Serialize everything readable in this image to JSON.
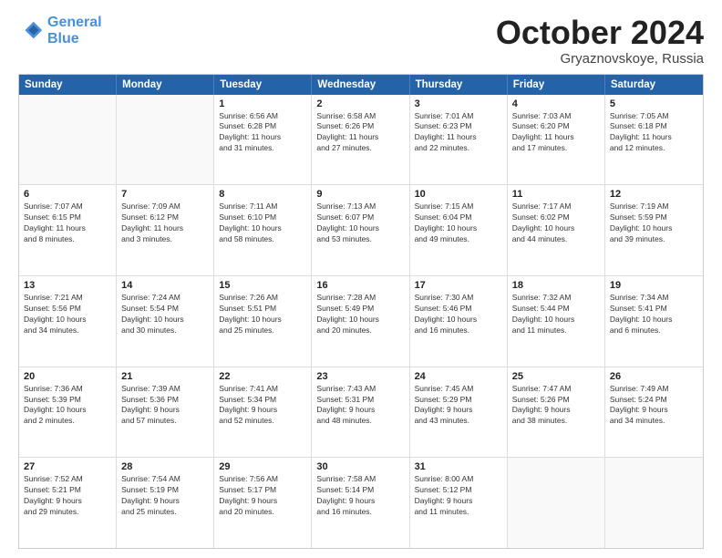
{
  "header": {
    "logo_line1": "General",
    "logo_line2": "Blue",
    "month": "October 2024",
    "location": "Gryaznovskoye, Russia"
  },
  "weekdays": [
    "Sunday",
    "Monday",
    "Tuesday",
    "Wednesday",
    "Thursday",
    "Friday",
    "Saturday"
  ],
  "rows": [
    [
      {
        "day": "",
        "text": ""
      },
      {
        "day": "",
        "text": ""
      },
      {
        "day": "1",
        "text": "Sunrise: 6:56 AM\nSunset: 6:28 PM\nDaylight: 11 hours\nand 31 minutes."
      },
      {
        "day": "2",
        "text": "Sunrise: 6:58 AM\nSunset: 6:26 PM\nDaylight: 11 hours\nand 27 minutes."
      },
      {
        "day": "3",
        "text": "Sunrise: 7:01 AM\nSunset: 6:23 PM\nDaylight: 11 hours\nand 22 minutes."
      },
      {
        "day": "4",
        "text": "Sunrise: 7:03 AM\nSunset: 6:20 PM\nDaylight: 11 hours\nand 17 minutes."
      },
      {
        "day": "5",
        "text": "Sunrise: 7:05 AM\nSunset: 6:18 PM\nDaylight: 11 hours\nand 12 minutes."
      }
    ],
    [
      {
        "day": "6",
        "text": "Sunrise: 7:07 AM\nSunset: 6:15 PM\nDaylight: 11 hours\nand 8 minutes."
      },
      {
        "day": "7",
        "text": "Sunrise: 7:09 AM\nSunset: 6:12 PM\nDaylight: 11 hours\nand 3 minutes."
      },
      {
        "day": "8",
        "text": "Sunrise: 7:11 AM\nSunset: 6:10 PM\nDaylight: 10 hours\nand 58 minutes."
      },
      {
        "day": "9",
        "text": "Sunrise: 7:13 AM\nSunset: 6:07 PM\nDaylight: 10 hours\nand 53 minutes."
      },
      {
        "day": "10",
        "text": "Sunrise: 7:15 AM\nSunset: 6:04 PM\nDaylight: 10 hours\nand 49 minutes."
      },
      {
        "day": "11",
        "text": "Sunrise: 7:17 AM\nSunset: 6:02 PM\nDaylight: 10 hours\nand 44 minutes."
      },
      {
        "day": "12",
        "text": "Sunrise: 7:19 AM\nSunset: 5:59 PM\nDaylight: 10 hours\nand 39 minutes."
      }
    ],
    [
      {
        "day": "13",
        "text": "Sunrise: 7:21 AM\nSunset: 5:56 PM\nDaylight: 10 hours\nand 34 minutes."
      },
      {
        "day": "14",
        "text": "Sunrise: 7:24 AM\nSunset: 5:54 PM\nDaylight: 10 hours\nand 30 minutes."
      },
      {
        "day": "15",
        "text": "Sunrise: 7:26 AM\nSunset: 5:51 PM\nDaylight: 10 hours\nand 25 minutes."
      },
      {
        "day": "16",
        "text": "Sunrise: 7:28 AM\nSunset: 5:49 PM\nDaylight: 10 hours\nand 20 minutes."
      },
      {
        "day": "17",
        "text": "Sunrise: 7:30 AM\nSunset: 5:46 PM\nDaylight: 10 hours\nand 16 minutes."
      },
      {
        "day": "18",
        "text": "Sunrise: 7:32 AM\nSunset: 5:44 PM\nDaylight: 10 hours\nand 11 minutes."
      },
      {
        "day": "19",
        "text": "Sunrise: 7:34 AM\nSunset: 5:41 PM\nDaylight: 10 hours\nand 6 minutes."
      }
    ],
    [
      {
        "day": "20",
        "text": "Sunrise: 7:36 AM\nSunset: 5:39 PM\nDaylight: 10 hours\nand 2 minutes."
      },
      {
        "day": "21",
        "text": "Sunrise: 7:39 AM\nSunset: 5:36 PM\nDaylight: 9 hours\nand 57 minutes."
      },
      {
        "day": "22",
        "text": "Sunrise: 7:41 AM\nSunset: 5:34 PM\nDaylight: 9 hours\nand 52 minutes."
      },
      {
        "day": "23",
        "text": "Sunrise: 7:43 AM\nSunset: 5:31 PM\nDaylight: 9 hours\nand 48 minutes."
      },
      {
        "day": "24",
        "text": "Sunrise: 7:45 AM\nSunset: 5:29 PM\nDaylight: 9 hours\nand 43 minutes."
      },
      {
        "day": "25",
        "text": "Sunrise: 7:47 AM\nSunset: 5:26 PM\nDaylight: 9 hours\nand 38 minutes."
      },
      {
        "day": "26",
        "text": "Sunrise: 7:49 AM\nSunset: 5:24 PM\nDaylight: 9 hours\nand 34 minutes."
      }
    ],
    [
      {
        "day": "27",
        "text": "Sunrise: 7:52 AM\nSunset: 5:21 PM\nDaylight: 9 hours\nand 29 minutes."
      },
      {
        "day": "28",
        "text": "Sunrise: 7:54 AM\nSunset: 5:19 PM\nDaylight: 9 hours\nand 25 minutes."
      },
      {
        "day": "29",
        "text": "Sunrise: 7:56 AM\nSunset: 5:17 PM\nDaylight: 9 hours\nand 20 minutes."
      },
      {
        "day": "30",
        "text": "Sunrise: 7:58 AM\nSunset: 5:14 PM\nDaylight: 9 hours\nand 16 minutes."
      },
      {
        "day": "31",
        "text": "Sunrise: 8:00 AM\nSunset: 5:12 PM\nDaylight: 9 hours\nand 11 minutes."
      },
      {
        "day": "",
        "text": ""
      },
      {
        "day": "",
        "text": ""
      }
    ]
  ]
}
